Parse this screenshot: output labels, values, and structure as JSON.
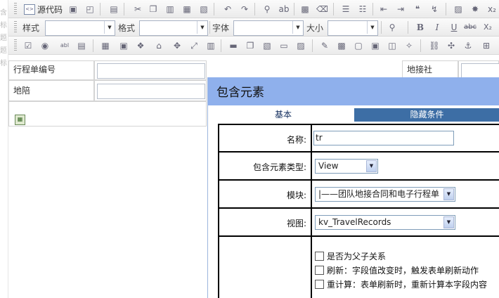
{
  "left_gutter": {
    "chars": [
      "含",
      "标",
      "题",
      "题",
      "标"
    ]
  },
  "toolbar1": {
    "source_label": "源代码",
    "icons": [
      "save-icon",
      "preview-icon",
      "template-icon",
      "cut-icon",
      "copy-icon",
      "paste-icon",
      "paste-text-icon",
      "undo-icon",
      "redo-icon",
      "find-icon",
      "replace-icon",
      "select-all-icon",
      "remove-format-icon",
      "ordered-list-icon",
      "unordered-list-icon",
      "outdent-icon",
      "indent-icon",
      "blockquote-icon",
      "div-icon",
      "image-icon",
      "flash-icon",
      "subscript-icon"
    ]
  },
  "toolbar2": {
    "style_label": "样式",
    "format_label": "格式",
    "font_label": "字体",
    "size_label": "大小",
    "style_value": "",
    "format_value": "",
    "font_value": "",
    "size_value": "",
    "bold": "B",
    "italic": "I",
    "underline": "U",
    "strike": "abc",
    "subscript": "X₂"
  },
  "toolbar3": {
    "icons": [
      "checkbox-icon",
      "radio-icon",
      "textfield-icon",
      "textarea-icon",
      "table-icon",
      "calendar-icon",
      "tree-icon",
      "house-icon",
      "drag-icon",
      "fit-icon",
      "grid-icon",
      "line-icon",
      "clone-icon",
      "calc-icon",
      "form-icon",
      "list-icon",
      "edit-icon",
      "picture-icon",
      "window-icon",
      "image-icon",
      "embed-icon",
      "special-icon",
      "link-icon",
      "unlink-icon",
      "anchor-icon"
    ]
  },
  "form": {
    "row1_label": "行程单编号",
    "row1_value": "",
    "row1_right_label": "地接社",
    "row2_label": "地陪",
    "row2_value": ""
  },
  "dialog": {
    "title": "包含元素",
    "tab_basic": "基本",
    "tab_conditions": "隐藏条件",
    "name_label": "名称:",
    "name_value": "tr",
    "type_label": "包含元素类型:",
    "type_value": "View",
    "module_label": "模块:",
    "module_value": "|——团队地接合同和电子行程单",
    "view_label": "视图:",
    "view_value": "kv_TravelRecords",
    "checkbox1_label": "是否为父子关系",
    "checkbox2_label": "刷新：字段值改变时，触发表单刷新动作",
    "checkbox3_label": "重计算：表单刷新时，重新计算本字段内容",
    "checkbox1_checked": false,
    "checkbox2_checked": false,
    "checkbox3_checked": false
  }
}
